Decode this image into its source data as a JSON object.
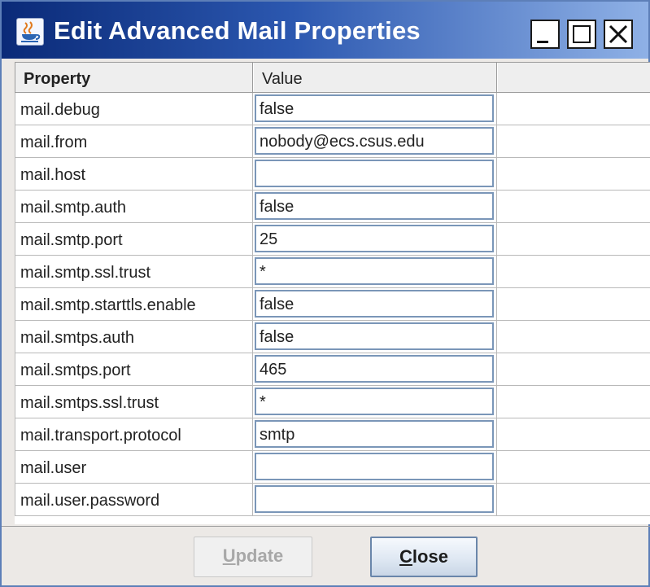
{
  "window": {
    "title": "Edit Advanced Mail Properties",
    "icon": "java-cup-icon",
    "controls": [
      "minimize",
      "maximize",
      "close"
    ]
  },
  "table": {
    "headers": {
      "property": "Property",
      "value": "Value"
    },
    "rows": [
      {
        "property": "mail.debug",
        "value": "false"
      },
      {
        "property": "mail.from",
        "value": "nobody@ecs.csus.edu"
      },
      {
        "property": "mail.host",
        "value": ""
      },
      {
        "property": "mail.smtp.auth",
        "value": "false"
      },
      {
        "property": "mail.smtp.port",
        "value": "25"
      },
      {
        "property": "mail.smtp.ssl.trust",
        "value": "*"
      },
      {
        "property": "mail.smtp.starttls.enable",
        "value": "false"
      },
      {
        "property": "mail.smtps.auth",
        "value": "false"
      },
      {
        "property": "mail.smtps.port",
        "value": "465"
      },
      {
        "property": "mail.smtps.ssl.trust",
        "value": "*"
      },
      {
        "property": "mail.transport.protocol",
        "value": "smtp"
      },
      {
        "property": "mail.user",
        "value": ""
      },
      {
        "property": "mail.user.password",
        "value": ""
      }
    ]
  },
  "buttons": {
    "update": {
      "mnemonic": "U",
      "rest": "pdate",
      "enabled": false
    },
    "close": {
      "mnemonic": "C",
      "rest": "lose",
      "enabled": true
    }
  },
  "colors": {
    "title_bar_start": "#0a2a78",
    "title_bar_end": "#8fb1e6",
    "field_border": "#7a96b8"
  }
}
